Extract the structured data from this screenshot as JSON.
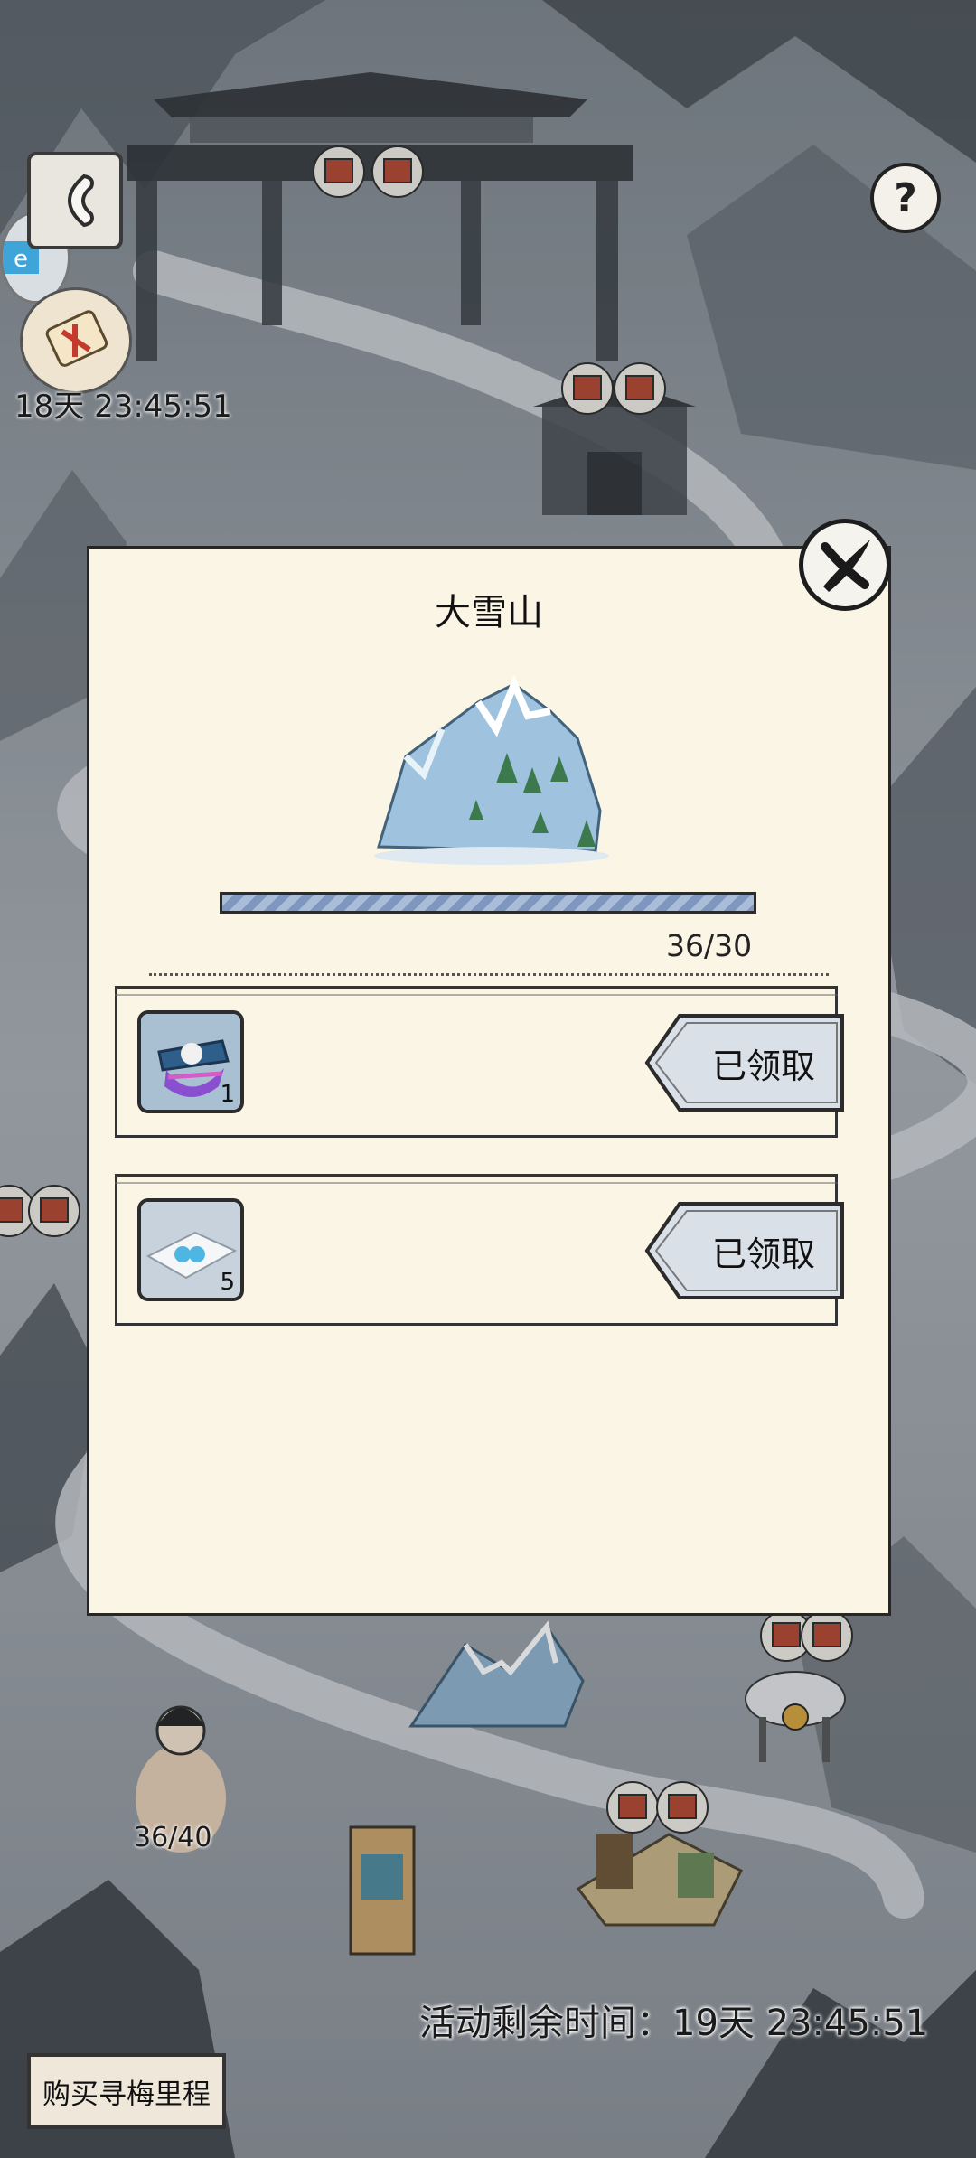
{
  "header": {
    "timer_label": "18天 23:45:51"
  },
  "map": {
    "player_progress": "36/40"
  },
  "footer": {
    "buy_button": "购买寻梅里程",
    "remaining_label": "活动剩余时间：",
    "remaining_value": "19天 23:45:51"
  },
  "popup": {
    "title": "大雪山",
    "progress_text": "36/30",
    "progress_fraction": 1.0,
    "rewards": [
      {
        "icon": "skull-hat-icon",
        "quantity": "1",
        "button": "已领取"
      },
      {
        "icon": "snowflake-paper-icon",
        "quantity": "5",
        "button": "已领取"
      }
    ]
  },
  "colors": {
    "panel": "#fbf5e6",
    "ink": "#1d1d1d",
    "progress_fill": "#8ea3c8"
  }
}
